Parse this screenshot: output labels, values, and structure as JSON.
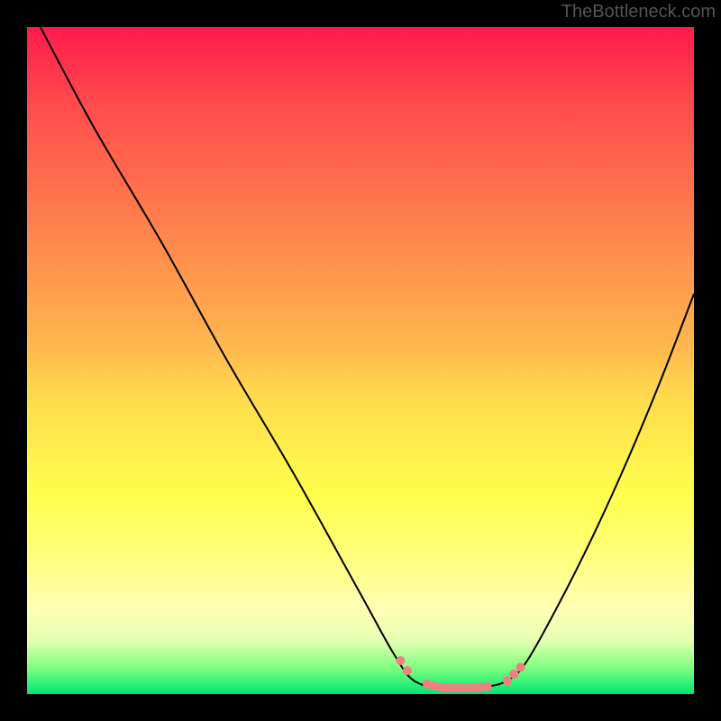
{
  "header": {
    "watermark": "TheBottleneck.com"
  },
  "chart_data": {
    "type": "line",
    "title": "",
    "xlabel": "",
    "ylabel": "",
    "xlim": [
      0,
      100
    ],
    "ylim": [
      0,
      100
    ],
    "series": [
      {
        "name": "bottleneck-curve",
        "color": "#000000",
        "stroke_width": 2,
        "points": [
          {
            "x": 2,
            "y": 100
          },
          {
            "x": 10,
            "y": 85
          },
          {
            "x": 20,
            "y": 68
          },
          {
            "x": 30,
            "y": 50
          },
          {
            "x": 40,
            "y": 33
          },
          {
            "x": 50,
            "y": 15
          },
          {
            "x": 55,
            "y": 6
          },
          {
            "x": 58,
            "y": 2
          },
          {
            "x": 62,
            "y": 1
          },
          {
            "x": 68,
            "y": 1
          },
          {
            "x": 72,
            "y": 2
          },
          {
            "x": 75,
            "y": 5
          },
          {
            "x": 80,
            "y": 14
          },
          {
            "x": 85,
            "y": 24
          },
          {
            "x": 90,
            "y": 35
          },
          {
            "x": 95,
            "y": 47
          },
          {
            "x": 100,
            "y": 60
          }
        ]
      },
      {
        "name": "highlight-dots",
        "color": "#f08080",
        "stroke_width": 10,
        "points": [
          {
            "x": 56,
            "y": 5
          },
          {
            "x": 57,
            "y": 3.5
          },
          {
            "x": 60,
            "y": 1.5
          },
          {
            "x": 61,
            "y": 1.2
          },
          {
            "x": 62,
            "y": 1
          },
          {
            "x": 63,
            "y": 0.9
          },
          {
            "x": 64,
            "y": 0.9
          },
          {
            "x": 65,
            "y": 0.9
          },
          {
            "x": 66,
            "y": 0.9
          },
          {
            "x": 67,
            "y": 0.9
          },
          {
            "x": 68,
            "y": 1
          },
          {
            "x": 69,
            "y": 1.1
          },
          {
            "x": 72,
            "y": 2
          },
          {
            "x": 73,
            "y": 3
          },
          {
            "x": 74,
            "y": 4
          }
        ]
      }
    ]
  }
}
